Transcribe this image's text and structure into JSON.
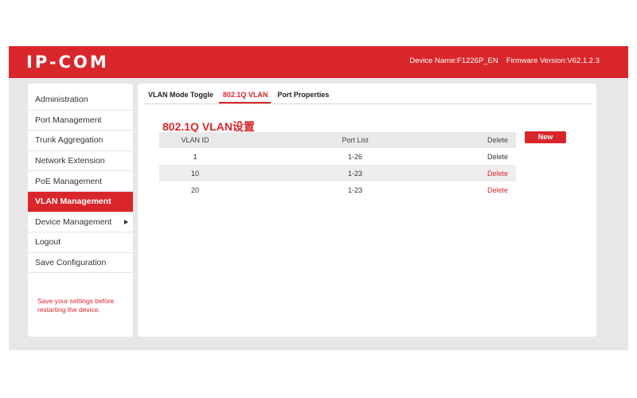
{
  "header": {
    "logo_text": "IP-COM",
    "device_name": "Device Name:F1226P_EN",
    "firmware_version": "Firmware Version:V62.1.2.3"
  },
  "sidebar": {
    "items": [
      {
        "label": "Administration"
      },
      {
        "label": "Port Management"
      },
      {
        "label": "Trunk Aggregation"
      },
      {
        "label": "Network Extension"
      },
      {
        "label": "PoE Management"
      },
      {
        "label": "VLAN Management",
        "active": true
      },
      {
        "label": "Device Management",
        "has_submenu_icon": "triangle-right-icon"
      },
      {
        "label": "Logout"
      },
      {
        "label": "Save Configuration"
      }
    ],
    "note": "Save your settings before restarting the device."
  },
  "tabs": [
    {
      "label": "VLAN Mode Toggle"
    },
    {
      "label": "802.1Q VLAN",
      "active": true
    },
    {
      "label": "Port Properties"
    }
  ],
  "page_title": "802.1Q VLAN设置",
  "table": {
    "columns": [
      "VLAN ID",
      "Port List",
      "Delete"
    ],
    "rows": [
      {
        "vlan_id": "1",
        "port_list": "1-26",
        "delete": "Delete"
      },
      {
        "vlan_id": "10",
        "port_list": "1-23",
        "delete": "Delete"
      },
      {
        "vlan_id": "20",
        "port_list": "1-23",
        "delete": "Delete"
      }
    ]
  },
  "new_button": "New",
  "colors": {
    "brand": "#d9262b",
    "background": "#e7e7e7"
  }
}
